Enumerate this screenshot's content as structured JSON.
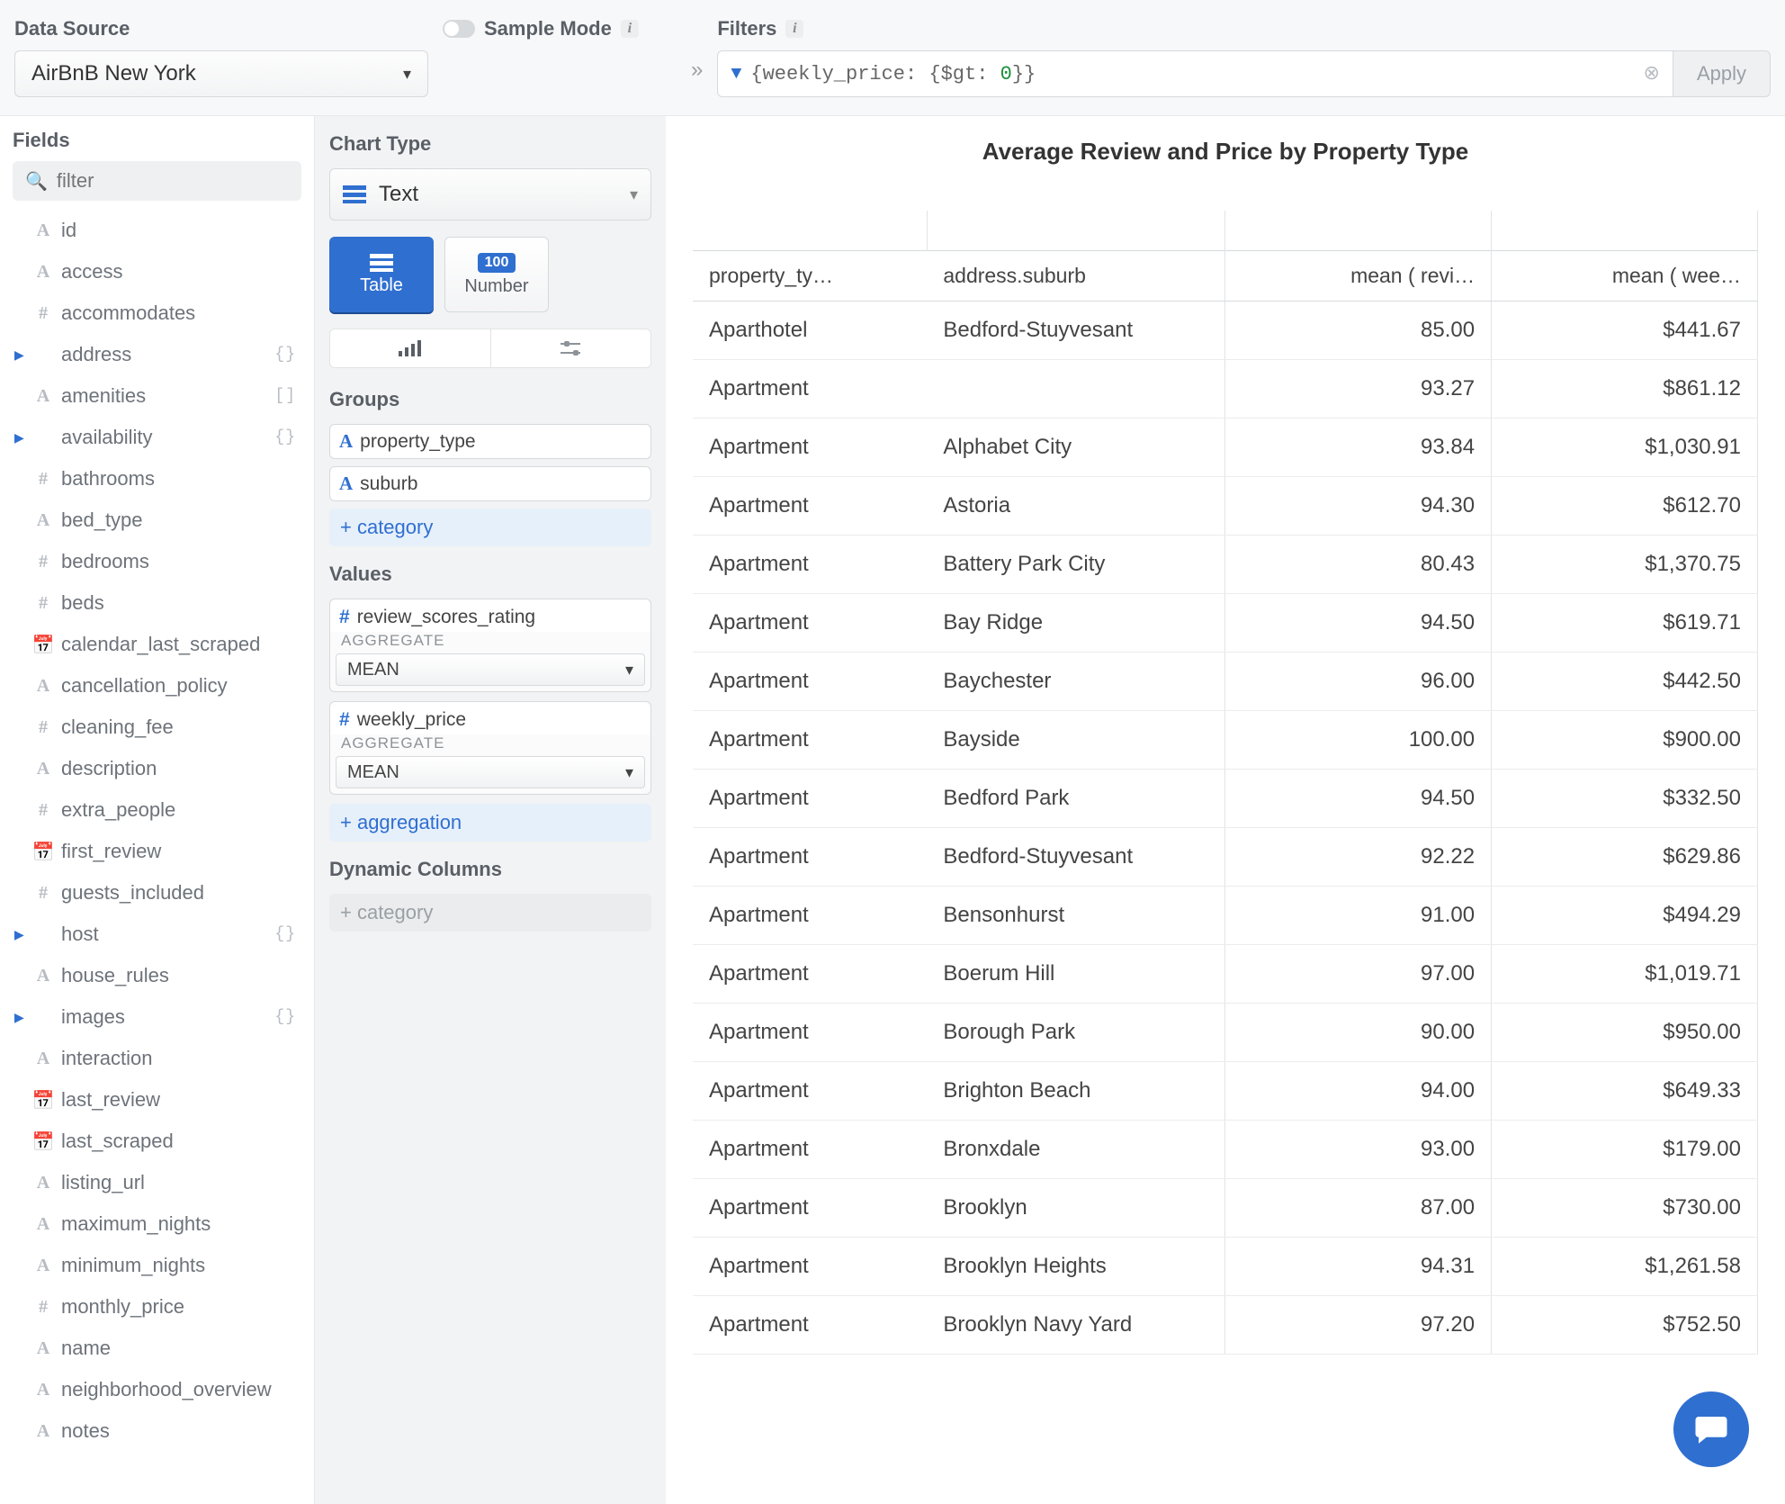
{
  "top": {
    "data_source_label": "Data Source",
    "data_source_value": "AirBnB New York",
    "sample_mode_label": "Sample Mode",
    "filters_label": "Filters",
    "filter_value_raw": "{weekly_price: {$gt: 0}}",
    "filter_value_num": "0",
    "apply_label": "Apply"
  },
  "fields": {
    "panel_title": "Fields",
    "filter_placeholder": "filter",
    "items": [
      {
        "type": "A",
        "name": "id"
      },
      {
        "type": "A",
        "name": "access"
      },
      {
        "type": "#",
        "name": "accommodates"
      },
      {
        "type": "obj",
        "name": "address",
        "expandable": true,
        "badge": "{}"
      },
      {
        "type": "A",
        "name": "amenities",
        "badge": "[]"
      },
      {
        "type": "obj",
        "name": "availability",
        "expandable": true,
        "badge": "{}"
      },
      {
        "type": "#",
        "name": "bathrooms"
      },
      {
        "type": "A",
        "name": "bed_type"
      },
      {
        "type": "#",
        "name": "bedrooms"
      },
      {
        "type": "#",
        "name": "beds"
      },
      {
        "type": "date",
        "name": "calendar_last_scraped"
      },
      {
        "type": "A",
        "name": "cancellation_policy"
      },
      {
        "type": "#",
        "name": "cleaning_fee"
      },
      {
        "type": "A",
        "name": "description"
      },
      {
        "type": "#",
        "name": "extra_people"
      },
      {
        "type": "date",
        "name": "first_review"
      },
      {
        "type": "#",
        "name": "guests_included"
      },
      {
        "type": "obj",
        "name": "host",
        "expandable": true,
        "badge": "{}"
      },
      {
        "type": "A",
        "name": "house_rules"
      },
      {
        "type": "obj",
        "name": "images",
        "expandable": true,
        "badge": "{}"
      },
      {
        "type": "A",
        "name": "interaction"
      },
      {
        "type": "date",
        "name": "last_review"
      },
      {
        "type": "date",
        "name": "last_scraped"
      },
      {
        "type": "A",
        "name": "listing_url"
      },
      {
        "type": "A",
        "name": "maximum_nights"
      },
      {
        "type": "A",
        "name": "minimum_nights"
      },
      {
        "type": "#",
        "name": "monthly_price"
      },
      {
        "type": "A",
        "name": "name"
      },
      {
        "type": "A",
        "name": "neighborhood_overview"
      },
      {
        "type": "A",
        "name": "notes"
      }
    ]
  },
  "config": {
    "chart_type_label": "Chart Type",
    "chart_type_value": "Text",
    "subtype_table": "Table",
    "subtype_number": "Number",
    "subtype_number_badge": "100",
    "groups_label": "Groups",
    "groups": [
      "property_type",
      "suburb"
    ],
    "add_category": "+ category",
    "values_label": "Values",
    "values": [
      {
        "field": "review_scores_rating",
        "agg_label": "AGGREGATE",
        "agg": "MEAN"
      },
      {
        "field": "weekly_price",
        "agg_label": "AGGREGATE",
        "agg": "MEAN"
      }
    ],
    "add_aggregation": "+ aggregation",
    "dynamic_cols_label": "Dynamic Columns",
    "dynamic_add": "+ category"
  },
  "chart": {
    "title": "Average Review and Price by Property Type",
    "columns": [
      "property_ty…",
      "address.suburb",
      "mean ( revi…",
      "mean ( wee…"
    ],
    "rows": [
      {
        "c1": "Aparthotel",
        "c2": "Bedford-Stuyvesant",
        "c3": "85.00",
        "c4": "$441.67"
      },
      {
        "c1": "Apartment",
        "c2": "",
        "c3": "93.27",
        "c4": "$861.12"
      },
      {
        "c1": "Apartment",
        "c2": "Alphabet City",
        "c3": "93.84",
        "c4": "$1,030.91"
      },
      {
        "c1": "Apartment",
        "c2": "Astoria",
        "c3": "94.30",
        "c4": "$612.70"
      },
      {
        "c1": "Apartment",
        "c2": "Battery Park City",
        "c3": "80.43",
        "c4": "$1,370.75"
      },
      {
        "c1": "Apartment",
        "c2": "Bay Ridge",
        "c3": "94.50",
        "c4": "$619.71"
      },
      {
        "c1": "Apartment",
        "c2": "Baychester",
        "c3": "96.00",
        "c4": "$442.50"
      },
      {
        "c1": "Apartment",
        "c2": "Bayside",
        "c3": "100.00",
        "c4": "$900.00"
      },
      {
        "c1": "Apartment",
        "c2": "Bedford Park",
        "c3": "94.50",
        "c4": "$332.50"
      },
      {
        "c1": "Apartment",
        "c2": "Bedford-Stuyvesant",
        "c3": "92.22",
        "c4": "$629.86"
      },
      {
        "c1": "Apartment",
        "c2": "Bensonhurst",
        "c3": "91.00",
        "c4": "$494.29"
      },
      {
        "c1": "Apartment",
        "c2": "Boerum Hill",
        "c3": "97.00",
        "c4": "$1,019.71"
      },
      {
        "c1": "Apartment",
        "c2": "Borough Park",
        "c3": "90.00",
        "c4": "$950.00"
      },
      {
        "c1": "Apartment",
        "c2": "Brighton Beach",
        "c3": "94.00",
        "c4": "$649.33"
      },
      {
        "c1": "Apartment",
        "c2": "Bronxdale",
        "c3": "93.00",
        "c4": "$179.00"
      },
      {
        "c1": "Apartment",
        "c2": "Brooklyn",
        "c3": "87.00",
        "c4": "$730.00"
      },
      {
        "c1": "Apartment",
        "c2": "Brooklyn Heights",
        "c3": "94.31",
        "c4": "$1,261.58"
      },
      {
        "c1": "Apartment",
        "c2": "Brooklyn Navy Yard",
        "c3": "97.20",
        "c4": "$752.50"
      }
    ]
  },
  "chart_data": {
    "type": "table",
    "title": "Average Review and Price by Property Type",
    "columns": [
      "property_type",
      "address.suburb",
      "mean(review_scores_rating)",
      "mean(weekly_price)"
    ],
    "rows": [
      [
        "Aparthotel",
        "Bedford-Stuyvesant",
        85.0,
        441.67
      ],
      [
        "Apartment",
        "",
        93.27,
        861.12
      ],
      [
        "Apartment",
        "Alphabet City",
        93.84,
        1030.91
      ],
      [
        "Apartment",
        "Astoria",
        94.3,
        612.7
      ],
      [
        "Apartment",
        "Battery Park City",
        80.43,
        1370.75
      ],
      [
        "Apartment",
        "Bay Ridge",
        94.5,
        619.71
      ],
      [
        "Apartment",
        "Baychester",
        96.0,
        442.5
      ],
      [
        "Apartment",
        "Bayside",
        100.0,
        900.0
      ],
      [
        "Apartment",
        "Bedford Park",
        94.5,
        332.5
      ],
      [
        "Apartment",
        "Bedford-Stuyvesant",
        92.22,
        629.86
      ],
      [
        "Apartment",
        "Bensonhurst",
        91.0,
        494.29
      ],
      [
        "Apartment",
        "Boerum Hill",
        97.0,
        1019.71
      ],
      [
        "Apartment",
        "Borough Park",
        90.0,
        950.0
      ],
      [
        "Apartment",
        "Brighton Beach",
        94.0,
        649.33
      ],
      [
        "Apartment",
        "Bronxdale",
        93.0,
        179.0
      ],
      [
        "Apartment",
        "Brooklyn",
        87.0,
        730.0
      ],
      [
        "Apartment",
        "Brooklyn Heights",
        94.31,
        1261.58
      ],
      [
        "Apartment",
        "Brooklyn Navy Yard",
        97.2,
        752.5
      ]
    ]
  }
}
